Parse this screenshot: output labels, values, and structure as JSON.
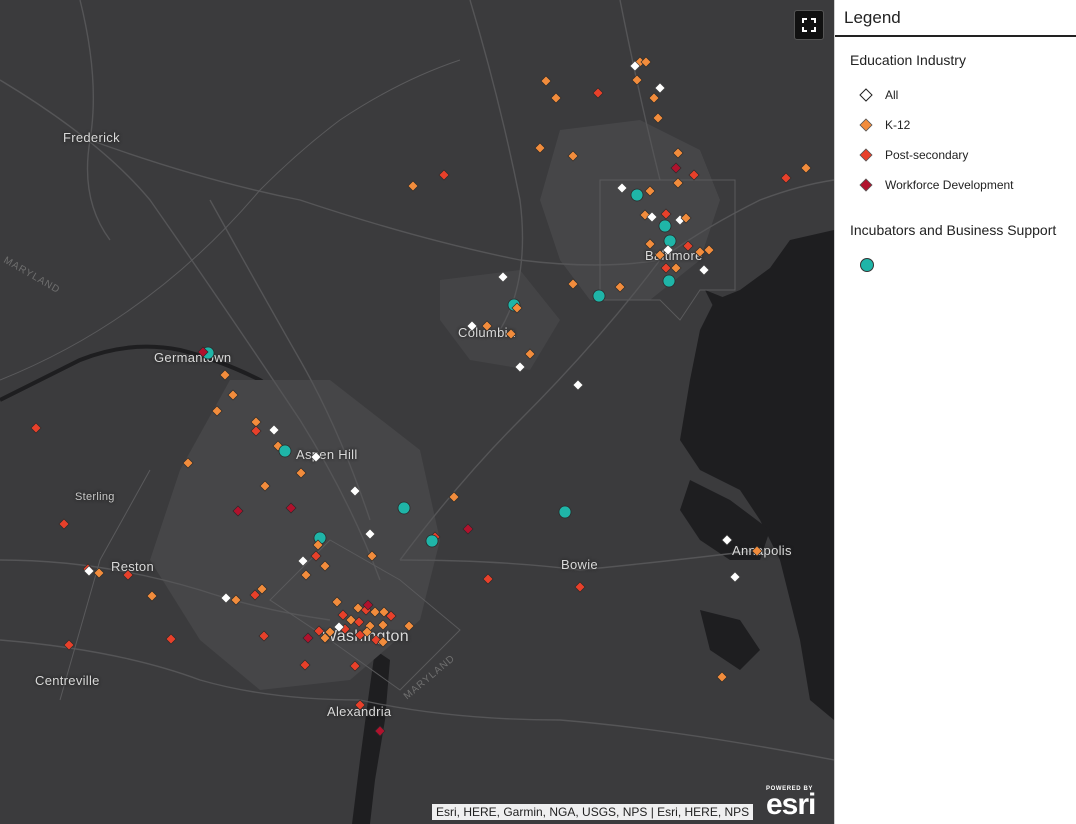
{
  "map": {
    "places": [
      {
        "id": "frederick",
        "label": "Frederick"
      },
      {
        "id": "germantown",
        "label": "Germantown"
      },
      {
        "id": "columbia",
        "label": "Columbia"
      },
      {
        "id": "baltimore",
        "label": "Baltimore"
      },
      {
        "id": "aspen-hill",
        "label": "Aspen Hill"
      },
      {
        "id": "sterling",
        "label": "Sterling"
      },
      {
        "id": "reston",
        "label": "Reston"
      },
      {
        "id": "bowie",
        "label": "Bowie"
      },
      {
        "id": "annapolis",
        "label": "Annapolis"
      },
      {
        "id": "washington",
        "label": "Washington"
      },
      {
        "id": "centreville",
        "label": "Centreville"
      },
      {
        "id": "alexandria",
        "label": "Alexandria"
      }
    ],
    "state_labels": [
      "MARYLAND",
      "MARYLAND"
    ],
    "attribution": "Esri, HERE, Garmin, NGA, USGS, NPS | Esri, HERE, NPS",
    "logo": {
      "powered": "POWERED BY",
      "word": "esri"
    },
    "fullscreen_icon": "fullscreen-icon"
  },
  "legend": {
    "title": "Legend",
    "layers": [
      {
        "title": "Education Industry",
        "items": [
          {
            "label": "All",
            "symbol": "diamond",
            "color": "#ffffff"
          },
          {
            "label": "K-12",
            "symbol": "diamond",
            "color": "#f28c3c"
          },
          {
            "label": "Post-secondary",
            "symbol": "diamond",
            "color": "#e8402a"
          },
          {
            "label": "Workforce Development",
            "symbol": "diamond",
            "color": "#b0122d"
          }
        ]
      },
      {
        "title": "Incubators and Business Support",
        "items": [
          {
            "label": "",
            "symbol": "circle",
            "color": "#1fb5a8"
          }
        ]
      }
    ]
  },
  "colors": {
    "all": "#ffffff",
    "k12": "#f28c3c",
    "post": "#e8402a",
    "workforce": "#b0122d",
    "incubator": "#1fb5a8",
    "map_bg": "#3b3b3d",
    "water": "#1e1e20"
  }
}
